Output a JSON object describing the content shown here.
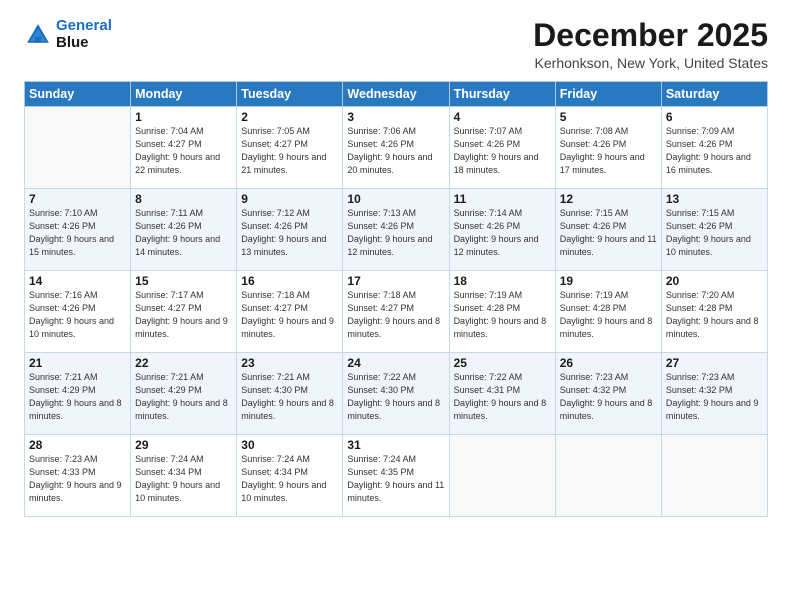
{
  "header": {
    "logo_line1": "General",
    "logo_line2": "Blue",
    "month_title": "December 2025",
    "location": "Kerhonkson, New York, United States"
  },
  "days_of_week": [
    "Sunday",
    "Monday",
    "Tuesday",
    "Wednesday",
    "Thursday",
    "Friday",
    "Saturday"
  ],
  "weeks": [
    [
      {
        "day": "",
        "sunrise": "",
        "sunset": "",
        "daylight": ""
      },
      {
        "day": "1",
        "sunrise": "Sunrise: 7:04 AM",
        "sunset": "Sunset: 4:27 PM",
        "daylight": "Daylight: 9 hours and 22 minutes."
      },
      {
        "day": "2",
        "sunrise": "Sunrise: 7:05 AM",
        "sunset": "Sunset: 4:27 PM",
        "daylight": "Daylight: 9 hours and 21 minutes."
      },
      {
        "day": "3",
        "sunrise": "Sunrise: 7:06 AM",
        "sunset": "Sunset: 4:26 PM",
        "daylight": "Daylight: 9 hours and 20 minutes."
      },
      {
        "day": "4",
        "sunrise": "Sunrise: 7:07 AM",
        "sunset": "Sunset: 4:26 PM",
        "daylight": "Daylight: 9 hours and 18 minutes."
      },
      {
        "day": "5",
        "sunrise": "Sunrise: 7:08 AM",
        "sunset": "Sunset: 4:26 PM",
        "daylight": "Daylight: 9 hours and 17 minutes."
      },
      {
        "day": "6",
        "sunrise": "Sunrise: 7:09 AM",
        "sunset": "Sunset: 4:26 PM",
        "daylight": "Daylight: 9 hours and 16 minutes."
      }
    ],
    [
      {
        "day": "7",
        "sunrise": "Sunrise: 7:10 AM",
        "sunset": "Sunset: 4:26 PM",
        "daylight": "Daylight: 9 hours and 15 minutes."
      },
      {
        "day": "8",
        "sunrise": "Sunrise: 7:11 AM",
        "sunset": "Sunset: 4:26 PM",
        "daylight": "Daylight: 9 hours and 14 minutes."
      },
      {
        "day": "9",
        "sunrise": "Sunrise: 7:12 AM",
        "sunset": "Sunset: 4:26 PM",
        "daylight": "Daylight: 9 hours and 13 minutes."
      },
      {
        "day": "10",
        "sunrise": "Sunrise: 7:13 AM",
        "sunset": "Sunset: 4:26 PM",
        "daylight": "Daylight: 9 hours and 12 minutes."
      },
      {
        "day": "11",
        "sunrise": "Sunrise: 7:14 AM",
        "sunset": "Sunset: 4:26 PM",
        "daylight": "Daylight: 9 hours and 12 minutes."
      },
      {
        "day": "12",
        "sunrise": "Sunrise: 7:15 AM",
        "sunset": "Sunset: 4:26 PM",
        "daylight": "Daylight: 9 hours and 11 minutes."
      },
      {
        "day": "13",
        "sunrise": "Sunrise: 7:15 AM",
        "sunset": "Sunset: 4:26 PM",
        "daylight": "Daylight: 9 hours and 10 minutes."
      }
    ],
    [
      {
        "day": "14",
        "sunrise": "Sunrise: 7:16 AM",
        "sunset": "Sunset: 4:26 PM",
        "daylight": "Daylight: 9 hours and 10 minutes."
      },
      {
        "day": "15",
        "sunrise": "Sunrise: 7:17 AM",
        "sunset": "Sunset: 4:27 PM",
        "daylight": "Daylight: 9 hours and 9 minutes."
      },
      {
        "day": "16",
        "sunrise": "Sunrise: 7:18 AM",
        "sunset": "Sunset: 4:27 PM",
        "daylight": "Daylight: 9 hours and 9 minutes."
      },
      {
        "day": "17",
        "sunrise": "Sunrise: 7:18 AM",
        "sunset": "Sunset: 4:27 PM",
        "daylight": "Daylight: 9 hours and 8 minutes."
      },
      {
        "day": "18",
        "sunrise": "Sunrise: 7:19 AM",
        "sunset": "Sunset: 4:28 PM",
        "daylight": "Daylight: 9 hours and 8 minutes."
      },
      {
        "day": "19",
        "sunrise": "Sunrise: 7:19 AM",
        "sunset": "Sunset: 4:28 PM",
        "daylight": "Daylight: 9 hours and 8 minutes."
      },
      {
        "day": "20",
        "sunrise": "Sunrise: 7:20 AM",
        "sunset": "Sunset: 4:28 PM",
        "daylight": "Daylight: 9 hours and 8 minutes."
      }
    ],
    [
      {
        "day": "21",
        "sunrise": "Sunrise: 7:21 AM",
        "sunset": "Sunset: 4:29 PM",
        "daylight": "Daylight: 9 hours and 8 minutes."
      },
      {
        "day": "22",
        "sunrise": "Sunrise: 7:21 AM",
        "sunset": "Sunset: 4:29 PM",
        "daylight": "Daylight: 9 hours and 8 minutes."
      },
      {
        "day": "23",
        "sunrise": "Sunrise: 7:21 AM",
        "sunset": "Sunset: 4:30 PM",
        "daylight": "Daylight: 9 hours and 8 minutes."
      },
      {
        "day": "24",
        "sunrise": "Sunrise: 7:22 AM",
        "sunset": "Sunset: 4:30 PM",
        "daylight": "Daylight: 9 hours and 8 minutes."
      },
      {
        "day": "25",
        "sunrise": "Sunrise: 7:22 AM",
        "sunset": "Sunset: 4:31 PM",
        "daylight": "Daylight: 9 hours and 8 minutes."
      },
      {
        "day": "26",
        "sunrise": "Sunrise: 7:23 AM",
        "sunset": "Sunset: 4:32 PM",
        "daylight": "Daylight: 9 hours and 8 minutes."
      },
      {
        "day": "27",
        "sunrise": "Sunrise: 7:23 AM",
        "sunset": "Sunset: 4:32 PM",
        "daylight": "Daylight: 9 hours and 9 minutes."
      }
    ],
    [
      {
        "day": "28",
        "sunrise": "Sunrise: 7:23 AM",
        "sunset": "Sunset: 4:33 PM",
        "daylight": "Daylight: 9 hours and 9 minutes."
      },
      {
        "day": "29",
        "sunrise": "Sunrise: 7:24 AM",
        "sunset": "Sunset: 4:34 PM",
        "daylight": "Daylight: 9 hours and 10 minutes."
      },
      {
        "day": "30",
        "sunrise": "Sunrise: 7:24 AM",
        "sunset": "Sunset: 4:34 PM",
        "daylight": "Daylight: 9 hours and 10 minutes."
      },
      {
        "day": "31",
        "sunrise": "Sunrise: 7:24 AM",
        "sunset": "Sunset: 4:35 PM",
        "daylight": "Daylight: 9 hours and 11 minutes."
      },
      {
        "day": "",
        "sunrise": "",
        "sunset": "",
        "daylight": ""
      },
      {
        "day": "",
        "sunrise": "",
        "sunset": "",
        "daylight": ""
      },
      {
        "day": "",
        "sunrise": "",
        "sunset": "",
        "daylight": ""
      }
    ]
  ]
}
